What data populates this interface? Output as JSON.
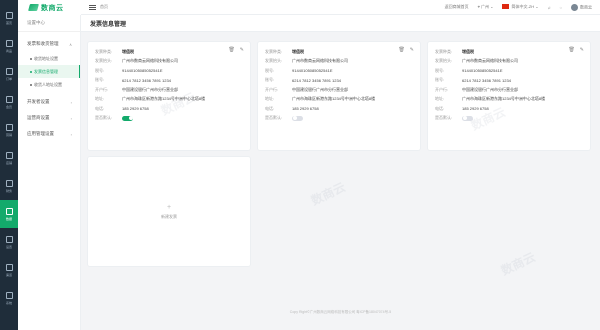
{
  "logo": {
    "text": "数商云"
  },
  "rail": [
    {
      "label": "首页",
      "icon": "home-icon"
    },
    {
      "label": "商品",
      "icon": "goods-icon"
    },
    {
      "label": "订单",
      "icon": "order-icon"
    },
    {
      "label": "会员",
      "icon": "member-icon"
    },
    {
      "label": "营销",
      "icon": "marketing-icon"
    },
    {
      "label": "店铺",
      "icon": "shop-icon"
    },
    {
      "label": "财务",
      "icon": "finance-icon"
    },
    {
      "label": "数据",
      "icon": "data-icon"
    },
    {
      "label": "设置",
      "icon": "settings-icon"
    },
    {
      "label": "渠道",
      "icon": "channel-icon"
    },
    {
      "label": "系统",
      "icon": "system-icon"
    }
  ],
  "sidebar": {
    "header": "设置中心",
    "menu": [
      {
        "label": "发票和收货管理"
      },
      {
        "label": "开发者设置"
      },
      {
        "label": "运营商设置"
      },
      {
        "label": "应用管理设置"
      }
    ],
    "submenu": [
      {
        "label": "收货地址设置"
      },
      {
        "label": "发票信息管理"
      },
      {
        "label": "收货人地址设置"
      }
    ]
  },
  "topbar": {
    "breadcrumb": "首页",
    "links": [
      "返回商城首页",
      "广州"
    ],
    "language": "简体中文-ZH",
    "user": "数商云"
  },
  "page": {
    "title": "发票信息管理"
  },
  "labels": {
    "invoice_type": "发票种类:",
    "title": "发票抬头:",
    "tax_no": "税号:",
    "account": "账号:",
    "bank": "开户行:",
    "address": "地址:",
    "phone": "电话:",
    "default": "是否默认:"
  },
  "invoices": [
    {
      "type": "增值税",
      "title": "广州市数商云网络科技有限公司",
      "tax_no": "91440105085052541E",
      "account": "6214 7812 3456 7891 1234",
      "bank": "中国建设银行广州市分行营业部",
      "address": "广州市海珠区新港东路1234号中洲中心北塔8楼",
      "phone": "185 2929 6758",
      "is_default": true
    },
    {
      "type": "增值税",
      "title": "广州市数商云网络科技有限公司",
      "tax_no": "91440105085052541E",
      "account": "6214 7812 3456 7891 1234",
      "bank": "中国建设银行广州市分行营业部",
      "address": "广州市海珠区新港东路1234号中洲中心北塔8楼",
      "phone": "185 2929 6758",
      "is_default": false
    },
    {
      "type": "增值税",
      "title": "广州市数商云网络科技有限公司",
      "tax_no": "91440105085052541E",
      "account": "6214 7812 3456 7891 1234",
      "bank": "中国建设银行广州市分行营业部",
      "address": "广州市海珠区新港东路1234号中洲中心北塔8楼",
      "phone": "185 2929 6758",
      "is_default": false
    }
  ],
  "add_card": {
    "label": "新建发票"
  },
  "footer": "Copy Right©广州数商云网络科技有限公司 粤ICP备18047074号-5",
  "colors": {
    "accent": "#13aa6b",
    "rail_bg": "#1f2d3a"
  }
}
